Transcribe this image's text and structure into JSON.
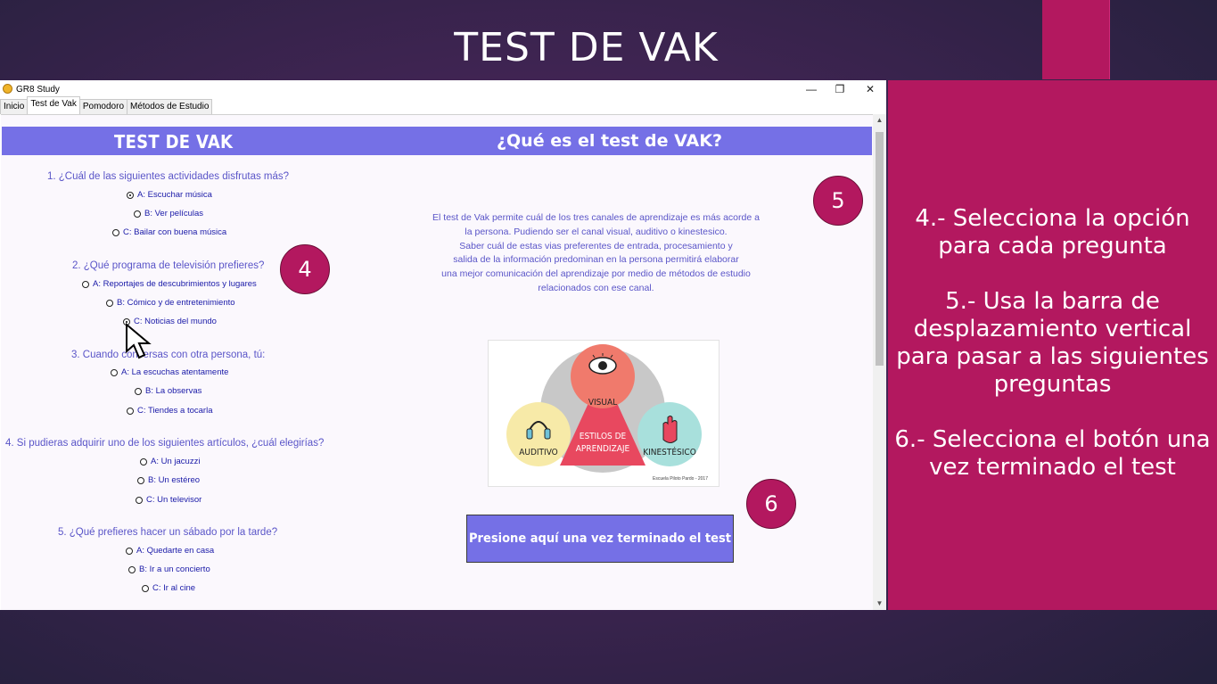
{
  "slide": {
    "title": "TEST DE VAK",
    "instructions": "4.- Selecciona la opción\npara cada pregunta\n\n5.- Usa la barra de\ndesplazamiento vertical\npara pasar a las siguientes\npreguntas\n\n6.- Selecciona el botón una\nvez terminado el test",
    "badges": [
      "4",
      "5",
      "6"
    ]
  },
  "window": {
    "title": "GR8 Study",
    "controls": {
      "minimize": "—",
      "maximize": "❐",
      "close": "✕"
    },
    "tabs": [
      "Inicio",
      "Test de Vak",
      "Pomodoro",
      "Métodos de Estudio"
    ],
    "active_tab": "Test de Vak"
  },
  "header": {
    "left": "TEST DE VAK",
    "right": "¿Qué es el test de VAK?"
  },
  "questions": [
    {
      "text": "1. ¿Cuál de las siguientes actividades disfrutas más?",
      "options": [
        "A: Escuchar música",
        "B: Ver películas",
        "C: Bailar con buena música"
      ],
      "selected": 0
    },
    {
      "text": "2. ¿Qué programa de televisión prefieres?",
      "options": [
        "A: Reportajes de descubrimientos y lugares",
        "B: Cómico y de entretenimiento",
        "C: Noticias del mundo"
      ],
      "selected": 2
    },
    {
      "text": "3. Cuando conversas con otra persona, tú:",
      "options": [
        "A: La escuchas atentamente",
        "B: La observas",
        "C: Tiendes a tocarla"
      ],
      "selected": -1
    },
    {
      "text": "4. Si pudieras adquirir uno de los siguientes artículos, ¿cuál elegirías?",
      "options": [
        "A: Un jacuzzi",
        "B: Un estéreo",
        "C: Un televisor"
      ],
      "selected": -1
    },
    {
      "text": "5. ¿Qué prefieres hacer un sábado por la tarde?",
      "options": [
        "A: Quedarte en casa",
        "B: Ir a un concierto",
        "C: Ir al cine"
      ],
      "selected": -1
    }
  ],
  "description": "El test de Vak permite cuál de los tres canales de aprendizaje es más acorde a\nla persona. Pudiendo ser el canal visual, auditivo o kinestesico.\nSaber cuál de estas vias preferentes de entrada, procesamiento y\nsalida de la información predominan en la persona permitirá elaborar\nuna mejor comunicación del aprendizaje por medio de métodos de estudio\nrelacionados con ese canal.",
  "image": {
    "visual": "VISUAL",
    "auditivo": "AUDITIVO",
    "kinestesico": "KINESTÉSICO",
    "center_line1": "ESTILOS DE",
    "center_line2": "APRENDIZAJE",
    "credit": "Escuela Piloto Pardo - 2017"
  },
  "finish_button": "Presione aquí una vez terminado el test",
  "colors": {
    "accent": "#7570e6",
    "magenta": "#b3185f",
    "question_text": "#5a55c8",
    "option_text": "#1a1aa8"
  }
}
